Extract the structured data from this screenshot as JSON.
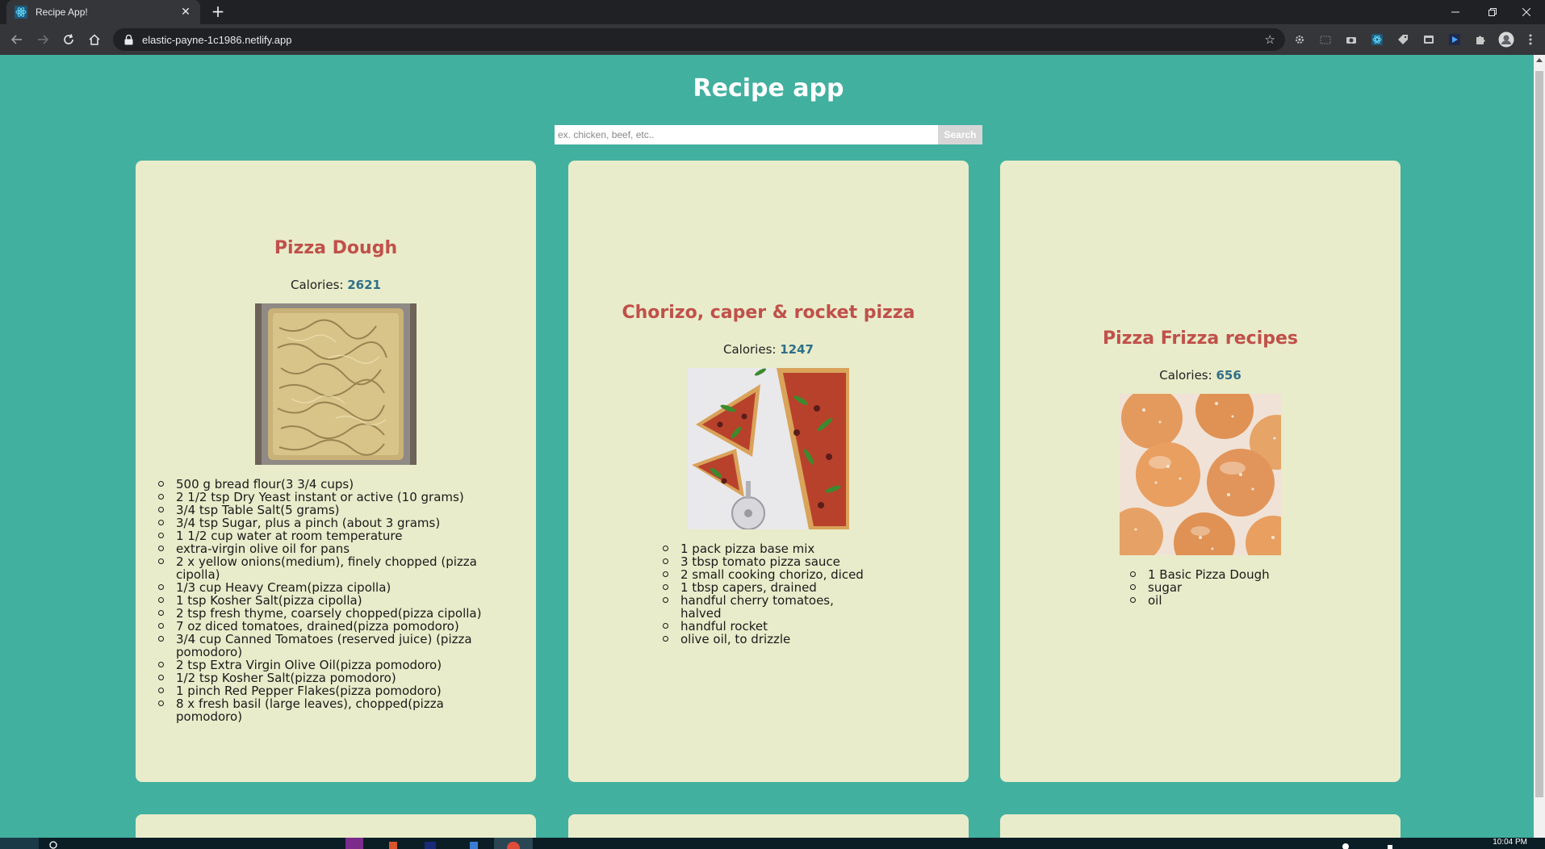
{
  "browser": {
    "tab_title": "Recipe App!",
    "new_tab_label": "+",
    "url": "elastic-payne-1c1986.netlify.app"
  },
  "app": {
    "title": "Recipe app",
    "search": {
      "placeholder": "ex. chicken, beef, etc..",
      "value": "",
      "button_label": "Search"
    }
  },
  "calories_label": "Calories:",
  "recipes": [
    {
      "title": "Pizza Dough",
      "calories": "2621",
      "image": "focaccia-with-onions",
      "ingredients": [
        "500 g bread flour(3 3/4 cups)",
        "2 1/2 tsp Dry Yeast instant or active (10 grams)",
        "3/4 tsp Table Salt(5 grams)",
        "3/4 tsp Sugar, plus a pinch (about 3 grams)",
        "1 1/2 cup water at room temperature",
        "extra-virgin olive oil for pans",
        "2 x yellow onions(medium), finely chopped (pizza cipolla)",
        "1/3 cup Heavy Cream(pizza cipolla)",
        "1 tsp Kosher Salt(pizza cipolla)",
        "2 tsp fresh thyme, coarsely chopped(pizza cipolla)",
        "7 oz diced tomatoes, drained(pizza pomodoro)",
        "3/4 cup Canned Tomatoes (reserved juice) (pizza pomodoro)",
        "2 tsp Extra Virgin Olive Oil(pizza pomodoro)",
        "1/2 tsp Kosher Salt(pizza pomodoro)",
        "1 pinch Red Pepper Flakes(pizza pomodoro)",
        "8 x fresh basil (large leaves), chopped(pizza pomodoro)"
      ]
    },
    {
      "title": "Chorizo, caper & rocket pizza",
      "calories": "1247",
      "image": "sliced-pizza-with-rocket",
      "ingredients": [
        "1 pack pizza base mix",
        "3 tbsp tomato pizza sauce",
        "2 small cooking chorizo, diced",
        "1 tbsp capers, drained",
        "handful cherry tomatoes, halved",
        "handful rocket",
        "olive oil, to drizzle"
      ]
    },
    {
      "title": "Pizza Frizza recipes",
      "calories": "656",
      "image": "sugared-dough-balls",
      "ingredients": [
        "1 Basic Pizza Dough",
        "sugar",
        "oil"
      ]
    }
  ],
  "taskbar": {
    "clock": "10:04 PM"
  },
  "colors": {
    "page_bg": "#42b09f",
    "card_bg": "#e8ecca",
    "title_red": "#c0504a",
    "calorie_blue": "#2f6f88"
  }
}
